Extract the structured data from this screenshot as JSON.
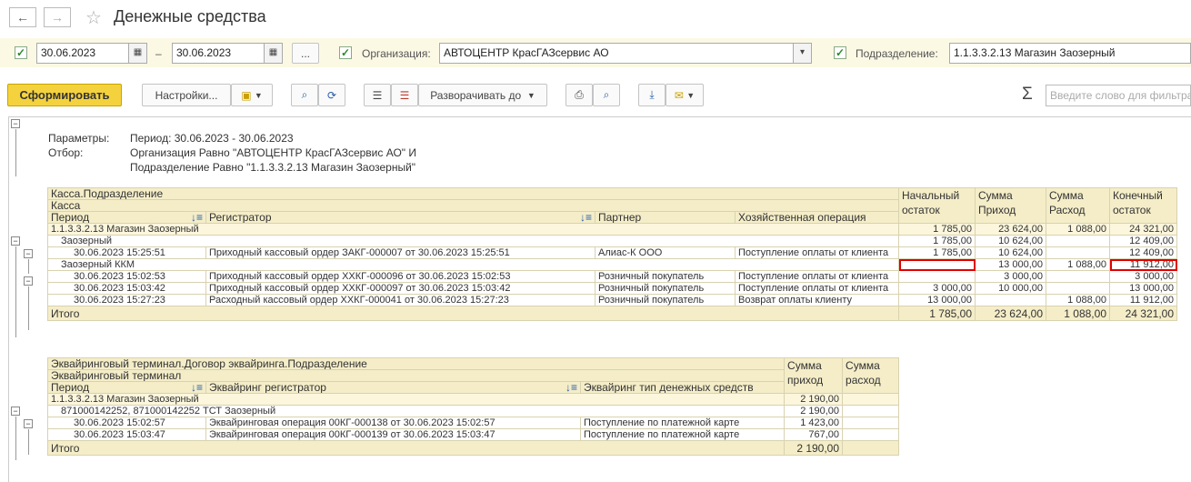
{
  "window": {
    "title": "Денежные средства",
    "back_icon": "←",
    "forward_icon": "→"
  },
  "filters": {
    "date_from": "30.06.2023",
    "date_dash": "–",
    "date_to": "30.06.2023",
    "dots_label": "...",
    "org_label": "Организация:",
    "org_value": "АВТОЦЕНТР КрасГАЗсервис АО",
    "dept_label": "Подразделение:",
    "dept_value": "1.1.3.3.2.13 Магазин Заозерный"
  },
  "toolbar": {
    "generate": "Сформировать",
    "settings": "Настройки...",
    "expand": "Разворачивать до",
    "search_placeholder": "Введите слово для фильтра"
  },
  "params": {
    "k1": "Параметры:",
    "v1": "Период: 30.06.2023 - 30.06.2023",
    "k2": "Отбор:",
    "v2": "Организация Равно \"АВТОЦЕНТР КрасГАЗсервис АО\" И",
    "v3": "Подразделение Равно \"1.1.3.3.2.13 Магазин Заозерный\""
  },
  "t1": {
    "h_group1": "Касса.Подразделение",
    "h_group2": "Касса",
    "h_period": "Период",
    "h_registrar": "Регистратор",
    "h_partner": "Партнер",
    "h_operation": "Хозяйственная операция",
    "h_begin": "Начальный остаток",
    "h_in": "Сумма Приход",
    "h_out": "Сумма Расход",
    "h_end": "Конечный остаток",
    "rows": [
      {
        "a": "1.1.3.3.2.13 Магазин Заозерный",
        "b": "",
        "c": "",
        "d": "",
        "n1": "1 785,00",
        "n2": "23 624,00",
        "n3": "1 088,00",
        "n4": "24 321,00"
      },
      {
        "a": "Заозерный",
        "b": "",
        "c": "",
        "d": "",
        "n1": "1 785,00",
        "n2": "10 624,00",
        "n3": "",
        "n4": "12 409,00"
      },
      {
        "a": "30.06.2023 15:25:51",
        "b": "Приходный кассовый ордер ЗАКГ-000007 от 30.06.2023 15:25:51",
        "c": "Алиас-К ООО",
        "d": "Поступление оплаты от клиента",
        "n1": "1 785,00",
        "n2": "10 624,00",
        "n3": "",
        "n4": "12 409,00"
      },
      {
        "a": "Заозерный ККМ",
        "b": "",
        "c": "",
        "d": "",
        "n1": "",
        "n2": "13 000,00",
        "n3": "1 088,00",
        "n4": "11 912,00"
      },
      {
        "a": "30.06.2023 15:02:53",
        "b": "Приходный кассовый ордер ХХКГ-000096 от 30.06.2023 15:02:53",
        "c": "Розничный покупатель",
        "d": "Поступление оплаты от клиента",
        "n1": "",
        "n2": "3 000,00",
        "n3": "",
        "n4": "3 000,00"
      },
      {
        "a": "30.06.2023 15:03:42",
        "b": "Приходный кассовый ордер ХХКГ-000097 от 30.06.2023 15:03:42",
        "c": "Розничный покупатель",
        "d": "Поступление оплаты от клиента",
        "n1": "3 000,00",
        "n2": "10 000,00",
        "n3": "",
        "n4": "13 000,00"
      },
      {
        "a": "30.06.2023 15:27:23",
        "b": "Расходный кассовый ордер ХХКГ-000041 от 30.06.2023 15:27:23",
        "c": "Розничный покупатель",
        "d": "Возврат оплаты клиенту",
        "n1": "13 000,00",
        "n2": "",
        "n3": "1 088,00",
        "n4": "11 912,00"
      }
    ],
    "total_label": "Итого",
    "total": {
      "n1": "1 785,00",
      "n2": "23 624,00",
      "n3": "1 088,00",
      "n4": "24 321,00"
    }
  },
  "t2": {
    "h_group1": "Эквайринговый терминал.Договор эквайринга.Подразделение",
    "h_group2": "Эквайринговый терминал",
    "h_period": "Период",
    "h_registrar": "Эквайринг регистратор",
    "h_type": "Эквайринг тип денежных средств",
    "h_in": "Сумма приход",
    "h_out": "Сумма расход",
    "rows": [
      {
        "a": "1.1.3.3.2.13 Магазин Заозерный",
        "b": "",
        "c": "",
        "n1": "2 190,00",
        "n2": ""
      },
      {
        "a": "871000142252, 871000142252 ТСТ Заозерный",
        "b": "",
        "c": "",
        "n1": "2 190,00",
        "n2": ""
      },
      {
        "a": "30.06.2023 15:02:57",
        "b": "Эквайринговая операция 00КГ-000138 от 30.06.2023 15:02:57",
        "c": "Поступление по платежной карте",
        "n1": "1 423,00",
        "n2": ""
      },
      {
        "a": "30.06.2023 15:03:47",
        "b": "Эквайринговая операция 00КГ-000139 от 30.06.2023 15:03:47",
        "c": "Поступление по платежной карте",
        "n1": "767,00",
        "n2": ""
      }
    ],
    "total_label": "Итого",
    "total": {
      "n1": "2 190,00",
      "n2": ""
    }
  }
}
